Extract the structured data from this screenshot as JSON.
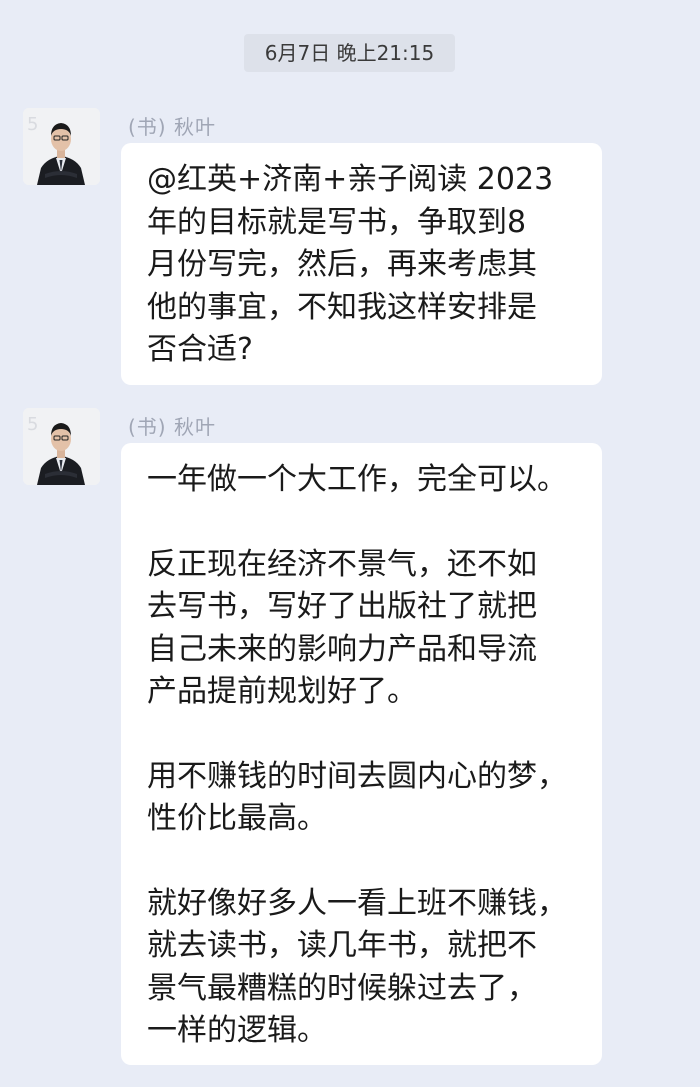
{
  "chat": {
    "timestamp": "6月7日 晚上21:15",
    "messages": [
      {
        "sender": "(书) 秋叶",
        "paragraphs": [
          [
            "@红英+济南+亲子阅读 2023",
            "年的目标就是写书，争取到8",
            "月份写完，然后，再来考虑其",
            "他的事宜，不知我这样安排是",
            "否合适?"
          ]
        ]
      },
      {
        "sender": "(书) 秋叶",
        "paragraphs": [
          [
            "一年做一个大工作，完全可以。"
          ],
          [
            "反正现在经济不景气，还不如",
            "去写书，写好了出版社了就把",
            "自己未来的影响力产品和导流",
            "产品提前规划好了。"
          ],
          [
            "用不赚钱的时间去圆内心的梦，",
            "性价比最高。"
          ],
          [
            "就好像好多人一看上班不赚钱，",
            "就去读书，读几年书，就把不",
            "景气最糟糕的时候躲过去了，",
            "一样的逻辑。"
          ]
        ]
      }
    ]
  }
}
